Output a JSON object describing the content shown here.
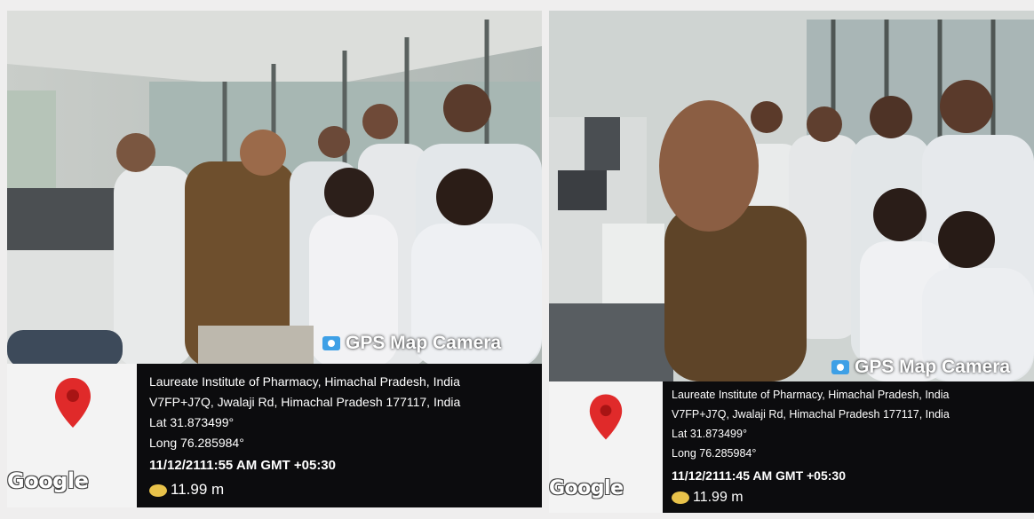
{
  "photos": [
    {
      "stamp": {
        "brand": "GPS Map Camera",
        "map_label": "Google",
        "location_name": "Laureate Institute of Pharmacy, Himachal Pradesh, India",
        "address": "V7FP+J7Q, Jwalaji Rd, Himachal Pradesh 177117, India",
        "lat": "Lat 31.873499°",
        "long": "Long 76.285984°",
        "datetime": "11/12/2111:55 AM GMT +05:30",
        "altitude": "11.99 m"
      }
    },
    {
      "stamp": {
        "brand": "GPS Map Camera",
        "map_label": "Google",
        "location_name": "Laureate Institute of Pharmacy, Himachal Pradesh, India",
        "address": "V7FP+J7Q, Jwalaji Rd, Himachal Pradesh 177117, India",
        "lat": "Lat 31.873499°",
        "long": "Long 76.285984°",
        "datetime": "11/12/2111:45 AM GMT +05:30",
        "altitude": "11.99 m"
      }
    }
  ],
  "colors": {
    "pin": "#e02a2a",
    "stamp_background": "#0c0c0e",
    "brand_icon": "#3ea0e6",
    "altitude_icon": "#e8c24a"
  },
  "icons": [
    "map-pin-icon",
    "camera-icon",
    "altitude-icon"
  ]
}
